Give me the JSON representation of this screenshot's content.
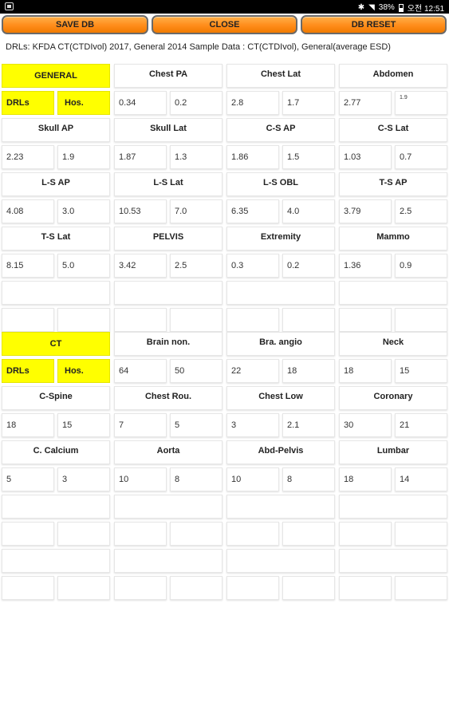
{
  "status_bar": {
    "battery": "38%",
    "time": "오전 12:51"
  },
  "toolbar": {
    "save_label": "SAVE DB",
    "close_label": "CLOSE",
    "reset_label": "DB RESET"
  },
  "info_text": "DRLs: KFDA CT(CTDIvol) 2017, General 2014  Sample Data : CT(CTDIvol), General(average ESD)",
  "general": {
    "title": "GENERAL",
    "drl_label": "DRLs",
    "hos_label": "Hos.",
    "items": [
      {
        "name": "Chest PA",
        "drl": "0.34",
        "hos": "0.2"
      },
      {
        "name": "Chest Lat",
        "drl": "2.8",
        "hos": "1.7"
      },
      {
        "name": "Abdomen",
        "drl": "2.77",
        "hos": "1.9"
      },
      {
        "name": "Skull AP",
        "drl": "2.23",
        "hos": "1.9"
      },
      {
        "name": "Skull Lat",
        "drl": "1.87",
        "hos": "1.3"
      },
      {
        "name": "C-S AP",
        "drl": "1.86",
        "hos": "1.5"
      },
      {
        "name": "C-S Lat",
        "drl": "1.03",
        "hos": "0.7"
      },
      {
        "name": "L-S AP",
        "drl": "4.08",
        "hos": "3.0"
      },
      {
        "name": "L-S Lat",
        "drl": "10.53",
        "hos": "7.0"
      },
      {
        "name": "L-S OBL",
        "drl": "6.35",
        "hos": "4.0"
      },
      {
        "name": "T-S AP",
        "drl": "3.79",
        "hos": "2.5"
      },
      {
        "name": "T-S Lat",
        "drl": "8.15",
        "hos": "5.0"
      },
      {
        "name": "PELVIS",
        "drl": "3.42",
        "hos": "2.5"
      },
      {
        "name": "Extremity",
        "drl": "0.3",
        "hos": "0.2"
      },
      {
        "name": "Mammo",
        "drl": "1.36",
        "hos": "0.9"
      }
    ]
  },
  "ct": {
    "title": "CT",
    "drl_label": "DRLs",
    "hos_label": "Hos.",
    "items": [
      {
        "name": "Brain non.",
        "drl": "64",
        "hos": "50"
      },
      {
        "name": "Bra. angio",
        "drl": "22",
        "hos": "18"
      },
      {
        "name": "Neck",
        "drl": "18",
        "hos": "15"
      },
      {
        "name": "C-Spine",
        "drl": "18",
        "hos": "15"
      },
      {
        "name": "Chest Rou.",
        "drl": "7",
        "hos": "5"
      },
      {
        "name": "Chest Low",
        "drl": "3",
        "hos": "2.1"
      },
      {
        "name": "Coronary",
        "drl": "30",
        "hos": "21"
      },
      {
        "name": "C. Calcium",
        "drl": "5",
        "hos": "3"
      },
      {
        "name": "Aorta",
        "drl": "10",
        "hos": "8"
      },
      {
        "name": "Abd-Pelvis",
        "drl": "10",
        "hos": "8"
      },
      {
        "name": "Lumbar",
        "drl": "18",
        "hos": "14"
      }
    ]
  }
}
